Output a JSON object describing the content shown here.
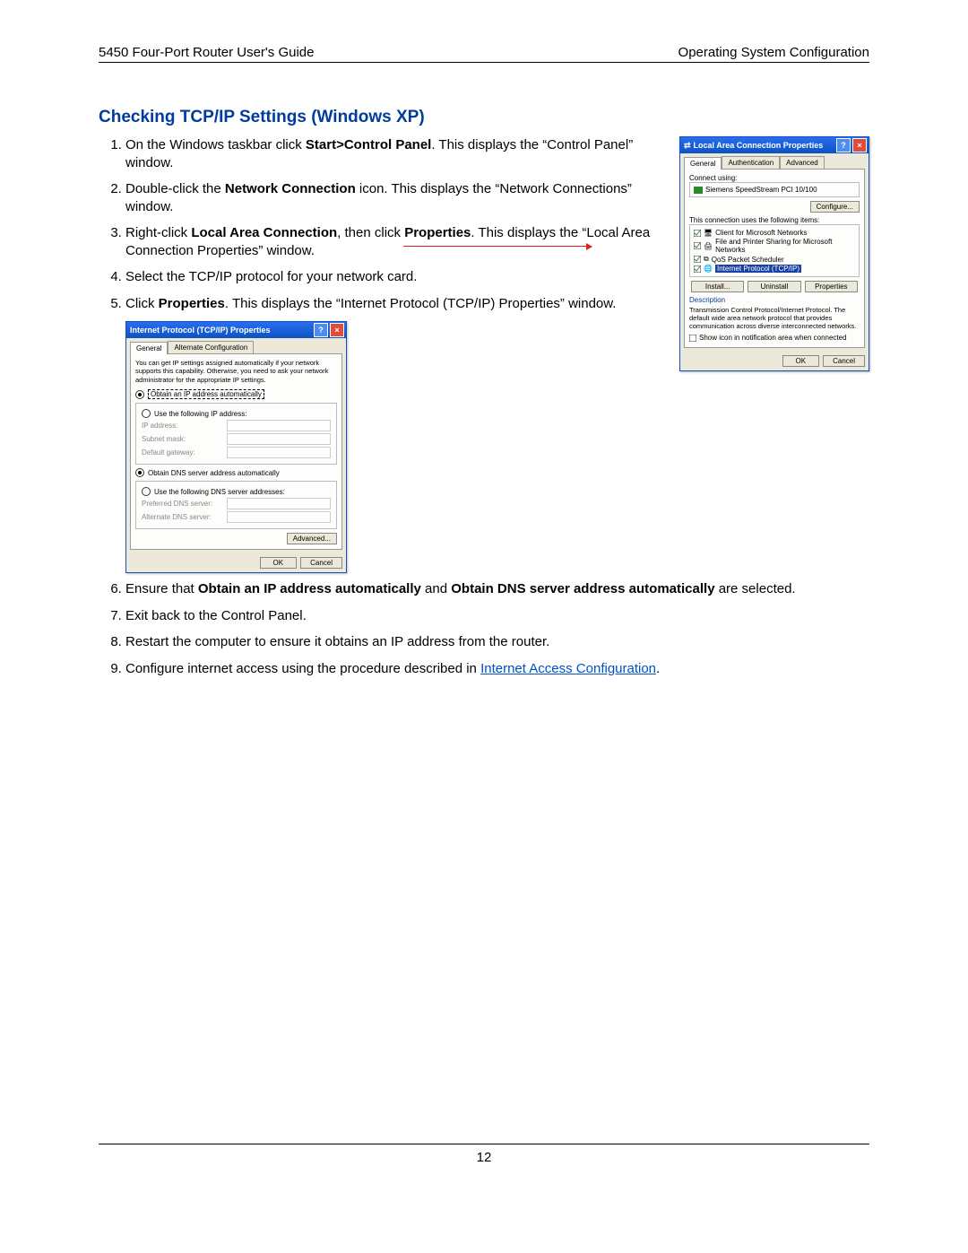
{
  "header": {
    "left": "5450 Four-Port Router User's Guide",
    "right": "Operating System Configuration"
  },
  "section_title": "Checking TCP/IP Settings (Windows XP)",
  "steps": {
    "s1a": "On the Windows taskbar click ",
    "s1b": "Start>Control Panel",
    "s1c": ". This displays the “Control Panel” window.",
    "s2a": " Double-click the ",
    "s2b": "Network Connection",
    "s2c": " icon. This displays the “Network Connections” window.",
    "s3a": "Right-click ",
    "s3b": "Local Area Connection",
    "s3c": ", then click ",
    "s3d": "Properties",
    "s3e": ". This displays the “Local Area Connection Properties” window.",
    "s4": "Select the TCP/IP protocol for your network card.",
    "s5a": "Click ",
    "s5b": "Properties",
    "s5c": ". This displays the “Internet Protocol (TCP/IP) Properties” window.",
    "s6a": "Ensure that ",
    "s6b": "Obtain an IP address automatically",
    "s6c": " and ",
    "s6d": "Obtain DNS server address automatically",
    "s6e": " are selected.",
    "s7": "Exit back to the Control Panel.",
    "s8": "Restart the computer to ensure it obtains an IP address from the router.",
    "s9a": "Configure internet access using the procedure described in ",
    "s9b": "Internet Access Configuration",
    "s9c": "."
  },
  "conn": {
    "title": "Local Area Connection Properties",
    "tabs": [
      "General",
      "Authentication",
      "Advanced"
    ],
    "connect_using_label": "Connect using:",
    "adapter": "Siemens SpeedStream PCI 10/100",
    "configure": "Configure...",
    "uses_label": "This connection uses the following items:",
    "items": [
      "Client for Microsoft Networks",
      "File and Printer Sharing for Microsoft Networks",
      "QoS Packet Scheduler",
      "Internet Protocol (TCP/IP)"
    ],
    "install": "Install...",
    "uninstall": "Uninstall",
    "properties": "Properties",
    "desc_label": "Description",
    "desc": "Transmission Control Protocol/Internet Protocol. The default wide area network protocol that provides communication across diverse interconnected networks.",
    "notify": "Show icon in notification area when connected",
    "ok": "OK",
    "cancel": "Cancel"
  },
  "tcp": {
    "title": "Internet Protocol (TCP/IP) Properties",
    "tabs": [
      "General",
      "Alternate Configuration"
    ],
    "blurb": "You can get IP settings assigned automatically if your network supports this capability. Otherwise, you need to ask your network administrator for the appropriate IP settings.",
    "r_auto_ip": "Obtain an IP address automatically",
    "r_use_ip": "Use the following IP address:",
    "ip": "IP address:",
    "mask": "Subnet mask:",
    "gw": "Default gateway:",
    "r_auto_dns": "Obtain DNS server address automatically",
    "r_use_dns": "Use the following DNS server addresses:",
    "pdns": "Preferred DNS server:",
    "adns": "Alternate DNS server:",
    "advanced": "Advanced...",
    "ok": "OK",
    "cancel": "Cancel"
  },
  "page_number": "12"
}
